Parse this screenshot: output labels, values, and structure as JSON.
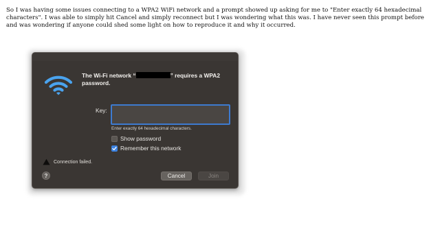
{
  "post": {
    "text": "So I was having some issues connecting to a WPA2 WiFi network and a prompt showed up asking for me to \"Enter exactly 64 hexadecimal characters\". I was able to simply hit Cancel and simply reconnect but I was wondering what this was. I have never seen this prompt before and was wondering if anyone could shed some light on how to reproduce it and why it occurred."
  },
  "dialog": {
    "title_prefix": "The Wi-Fi network “",
    "title_suffix": "” requires a WPA2 password.",
    "key_label": "Key:",
    "key_value": "",
    "hint": "Enter exactly 64 hexadecimal characters.",
    "show_password": {
      "label": "Show password",
      "checked": false
    },
    "remember_network": {
      "label": "Remember this network",
      "checked": true
    },
    "status": "Connection failed.",
    "help_label": "?",
    "cancel_label": "Cancel",
    "join_label": "Join",
    "icons": {
      "wifi": "wifi-icon",
      "warning": "warning-triangle-icon",
      "check": "checkmark-icon"
    },
    "colors": {
      "accent": "#3c82e0",
      "wifi": "#4aa3ee",
      "background": "#3a3633"
    }
  }
}
